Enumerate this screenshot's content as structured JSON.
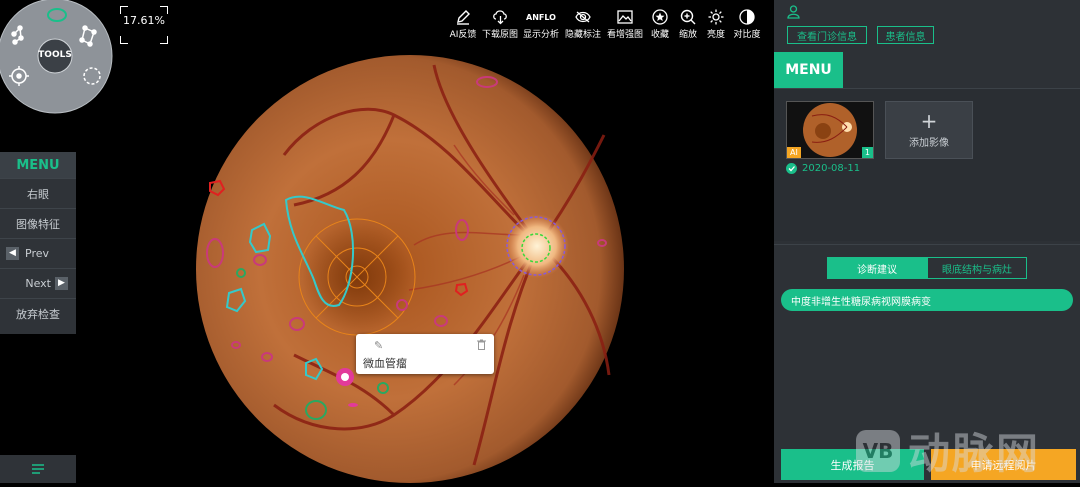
{
  "tools": {
    "label": "TOOLS"
  },
  "zoom": {
    "value": "17.61%"
  },
  "left_menu": {
    "title": "MENU",
    "items": [
      "右眼",
      "图像特征"
    ],
    "prev": "Prev",
    "next": "Next",
    "abandon": "放弃检查"
  },
  "toolbar": {
    "items": [
      {
        "icon": "pencil-icon",
        "label": "AI反馈"
      },
      {
        "icon": "cloud-download-icon",
        "label": "下载原图"
      },
      {
        "icon": "anflo-logo-icon",
        "icon_text": "ANFLO",
        "label": "显示分析"
      },
      {
        "icon": "eye-icon",
        "label": "隐藏标注"
      },
      {
        "icon": "image-icon",
        "label": "看增强图"
      },
      {
        "icon": "star-icon",
        "label": "收藏"
      },
      {
        "icon": "zoom-in-icon",
        "label": "缩放"
      },
      {
        "icon": "brightness-icon",
        "label": "亮度"
      },
      {
        "icon": "contrast-icon",
        "label": "对比度"
      }
    ]
  },
  "popup": {
    "label": "微血管瘤"
  },
  "right_panel": {
    "view_visit": "查看门诊信息",
    "patient_info": "患者信息",
    "menu": "MENU",
    "thumb_badge_ai": "AI",
    "thumb_badge_count": "1",
    "add_image": "添加影像",
    "date": "2020-08-11",
    "tabs": [
      "诊断建议",
      "眼底结构与病灶"
    ],
    "diagnosis": "中度非增生性糖尿病视网膜病变",
    "generate_report": "生成报告",
    "remote_read": "申请远程阅片"
  },
  "watermark": "动脉网",
  "colors": {
    "accent": "#1abf8a",
    "warning": "#f5a623",
    "panel": "#2d3136"
  }
}
